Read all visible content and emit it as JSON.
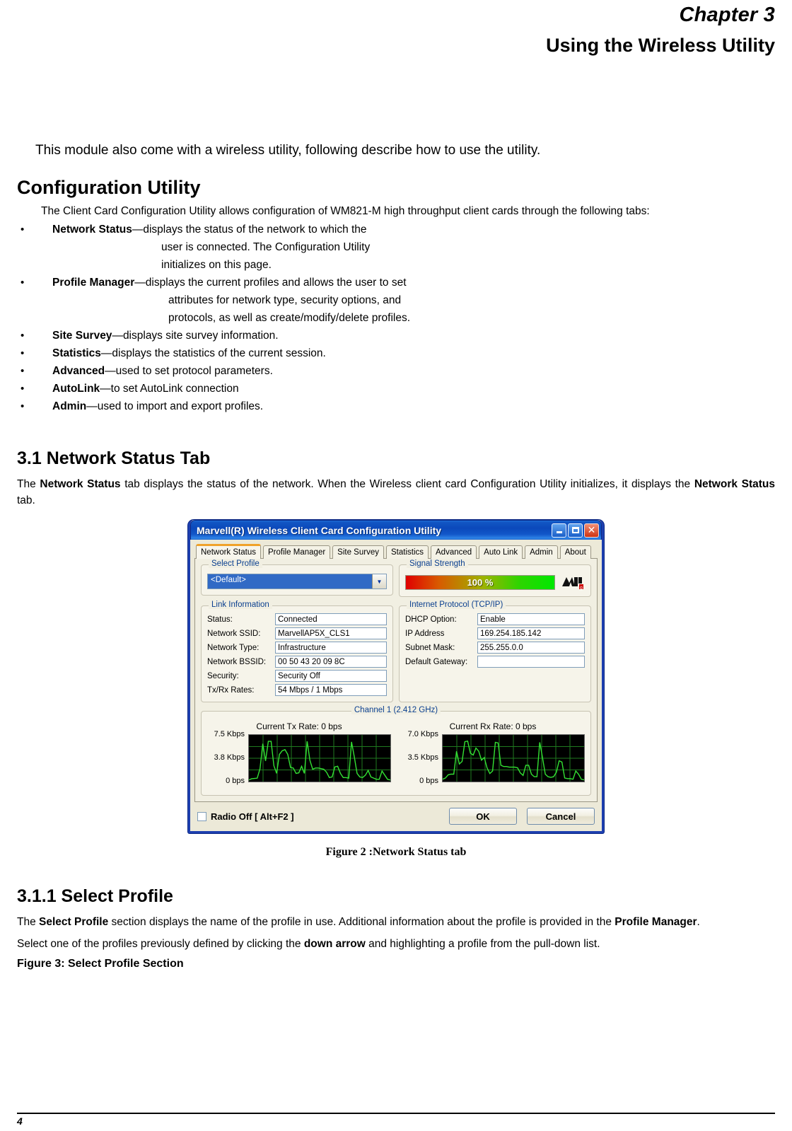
{
  "document": {
    "chapter_label": "Chapter 3",
    "chapter_title": "Using the Wireless Utility",
    "intro": "This module also come with a wireless utility, following describe how to use the utility.",
    "section_config_title": "Configuration Utility",
    "config_lead": "The Client Card Configuration Utility allows configuration of WM821-M high throughput client cards through the following tabs:",
    "bullet": "•",
    "tab_items": [
      {
        "term": "Network Status",
        "desc": "—displays the status of the network to which the",
        "cont": [
          "user is connected. The Configuration Utility",
          "initializes on this page."
        ]
      },
      {
        "term": "Profile Manager",
        "desc": "—displays the current profiles and allows the user to set",
        "cont": [
          "attributes for network type, security options, and",
          "protocols, as well as create/modify/delete profiles."
        ]
      },
      {
        "term": "Site Survey",
        "desc": "—displays site survey information.",
        "cont": []
      },
      {
        "term": "Statistics",
        "desc": "—displays the statistics of the current session.",
        "cont": []
      },
      {
        "term": "Advanced",
        "desc": "—used to set protocol parameters.",
        "cont": []
      },
      {
        "term": "AutoLink",
        "desc": "—to set AutoLink connection",
        "cont": []
      },
      {
        "term": "Admin",
        "desc": "—used to import and export profiles.",
        "cont": []
      }
    ],
    "section_31_title": "3.1 Network Status Tab",
    "section_31_p1_a": "The ",
    "section_31_p1_b1": "Network Status",
    "section_31_p1_c": " tab displays the status of the network. When the Wireless client card Configuration Utility initializes, it displays the ",
    "section_31_p1_b2": "Network Status",
    "section_31_p1_d": " tab.",
    "figure2_caption": "Figure 2 :Network Status tab",
    "section_311_title": "3.1.1 Select Profile",
    "section_311_p1_a": "The ",
    "section_311_p1_b1": "Select Profile",
    "section_311_p1_c": " section displays the name of the profile in use. Additional information about the profile is provided in the ",
    "section_311_p1_b2": "Profile Manager",
    "section_311_p1_d": ".",
    "section_311_p2_a": "Select one of the profiles previously defined by clicking the ",
    "section_311_p2_b": "down arrow",
    "section_311_p2_c": " and highlighting a profile from the pull-down list.",
    "figure3_label": "Figure 3: Select Profile Section",
    "page_number": "4"
  },
  "dialog": {
    "title": "Marvell(R) Wireless Client Card Configuration Utility",
    "window_buttons": {
      "minimize": "minimize-icon",
      "maximize": "maximize-icon",
      "close": "✕"
    },
    "tabs": [
      {
        "label": "Network Status",
        "active": true
      },
      {
        "label": "Profile Manager",
        "active": false
      },
      {
        "label": "Site Survey",
        "active": false
      },
      {
        "label": "Statistics",
        "active": false
      },
      {
        "label": "Advanced",
        "active": false
      },
      {
        "label": "Auto Link",
        "active": false
      },
      {
        "label": "Admin",
        "active": false
      },
      {
        "label": "About",
        "active": false
      }
    ],
    "select_profile": {
      "legend": "Select Profile",
      "value": "<Default>",
      "arrow": "▼"
    },
    "signal_strength": {
      "legend": "Signal Strength",
      "value": "100 %",
      "logo": "marvell-logo-icon"
    },
    "link_information": {
      "legend": "Link Information",
      "fields": [
        {
          "label": "Status:",
          "value": "Connected"
        },
        {
          "label": "Network SSID:",
          "value": "MarvellAP5X_CLS1"
        },
        {
          "label": "Network Type:",
          "value": "Infrastructure"
        },
        {
          "label": "Network BSSID:",
          "value": "00 50 43 20 09 8C"
        },
        {
          "label": "Security:",
          "value": "Security Off"
        },
        {
          "label": "Tx/Rx Rates:",
          "value": "54 Mbps / 1 Mbps"
        }
      ]
    },
    "tcpip": {
      "legend": "Internet Protocol (TCP/IP)",
      "fields": [
        {
          "label": "DHCP Option:",
          "value": "Enable"
        },
        {
          "label": "IP Address",
          "value": "169.254.185.142"
        },
        {
          "label": "Subnet Mask:",
          "value": "255.255.0.0"
        },
        {
          "label": "Default Gateway:",
          "value": ""
        }
      ]
    },
    "channel": {
      "legend": "Channel 1 (2.412 GHz)",
      "tx": {
        "title": "Current Tx Rate: 0 bps",
        "y_ticks": [
          "7.5 Kbps",
          "3.8 Kbps",
          "0 bps"
        ]
      },
      "rx": {
        "title": "Current Rx Rate: 0 bps",
        "y_ticks": [
          "7.0 Kbps",
          "3.5 Kbps",
          "0 bps"
        ]
      }
    },
    "radio_off_label": "Radio Off  [ Alt+F2 ]",
    "ok_label": "OK",
    "cancel_label": "Cancel"
  },
  "colors": {
    "titlebar_blue": "#0b49bb",
    "window_border": "#1d3fb0",
    "legend_text": "#0a3f8f",
    "active_tab_accent": "#f0a22a",
    "selection_blue": "#316ac5",
    "graph_line": "#33e033",
    "graph_grid": "#1f7a1f",
    "signal_red": "#e00000",
    "signal_green": "#00e800"
  },
  "chart_data": [
    {
      "type": "line",
      "title": "Current Tx Rate: 0 bps",
      "ylabel": "",
      "xlabel": "",
      "ylim": [
        0,
        7.5
      ],
      "ytick_labels": [
        "7.5 Kbps",
        "3.8 Kbps",
        "0 bps"
      ],
      "ytick_values": [
        7.5,
        3.8,
        0
      ],
      "grid": true,
      "values": [
        0.1,
        0.3,
        0.35,
        0.4,
        2.0,
        6.2,
        3.3,
        6.6,
        6.6,
        2.5,
        1.2,
        4.4,
        5.0,
        5.2,
        4.4,
        2.2,
        2.1,
        1.2,
        1.3,
        2.4,
        1.2,
        6.6,
        3.4,
        1.9,
        2.1,
        2.1,
        2.0,
        1.9,
        1.4,
        0.5,
        0.6,
        2.3,
        2.4,
        1.2,
        0.5,
        0.5,
        0.4,
        6.5,
        4.0,
        1.2,
        0.6,
        0.5,
        0.9,
        1.7,
        0.6,
        0.4,
        0.2,
        0.2,
        1.6,
        0.9,
        0.2,
        0.1
      ]
    },
    {
      "type": "line",
      "title": "Current Rx Rate: 0 bps",
      "ylabel": "",
      "xlabel": "",
      "ylim": [
        0,
        7.0
      ],
      "ytick_labels": [
        "7.0 Kbps",
        "3.5 Kbps",
        "0 bps"
      ],
      "ytick_values": [
        7.0,
        3.5,
        0
      ],
      "grid": true,
      "values": [
        0.2,
        0.4,
        0.9,
        1.0,
        1.0,
        4.6,
        2.6,
        3.0,
        6.1,
        6.2,
        4.3,
        4.0,
        5.1,
        4.6,
        3.2,
        3.6,
        2.0,
        1.1,
        1.5,
        6.0,
        5.9,
        2.4,
        2.2,
        2.2,
        2.1,
        2.1,
        2.1,
        2.0,
        1.2,
        0.8,
        2.4,
        2.4,
        1.0,
        0.6,
        0.6,
        6.0,
        3.6,
        1.0,
        0.6,
        0.5,
        0.6,
        1.3,
        3.1,
        2.9,
        0.4,
        0.3,
        0.3,
        0.2,
        1.5,
        1.0,
        0.2,
        0.1
      ]
    }
  ]
}
